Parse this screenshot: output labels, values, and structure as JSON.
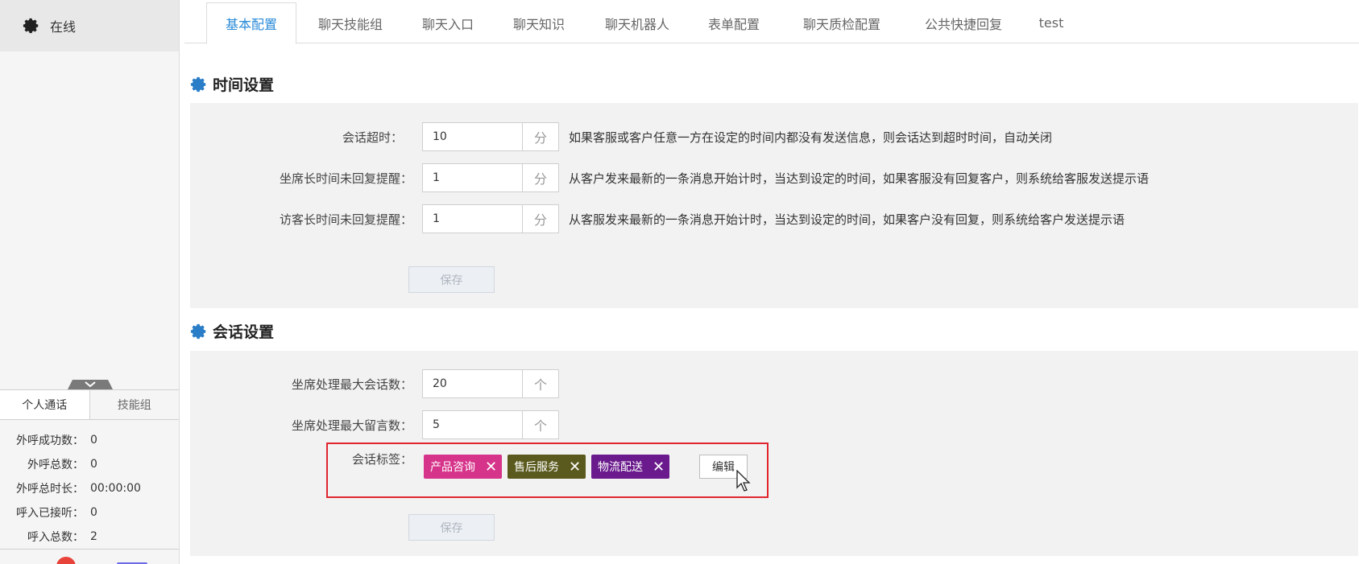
{
  "sidebar": {
    "status_label": "在线",
    "tabs": [
      "个人通话",
      "技能组"
    ],
    "stats": [
      {
        "k": "外呼成功数：",
        "v": "0"
      },
      {
        "k": "外呼总数：",
        "v": "0"
      },
      {
        "k": "外呼总时长：",
        "v": "00:00:00"
      },
      {
        "k": "呼入已接听：",
        "v": "0"
      },
      {
        "k": "呼入总数：",
        "v": "2"
      }
    ]
  },
  "tabs": [
    "基本配置",
    "聊天技能组",
    "聊天入口",
    "聊天知识",
    "聊天机器人",
    "表单配置",
    "聊天质检配置",
    "公共快捷回复",
    "test"
  ],
  "time_settings": {
    "title": "时间设置",
    "rows": [
      {
        "label": "会话超时：",
        "value": "10",
        "unit": "分",
        "desc": "如果客服或客户任意一方在设定的时间内都没有发送信息，则会话达到超时时间，自动关闭"
      },
      {
        "label": "坐席长时间未回复提醒：",
        "value": "1",
        "unit": "分",
        "desc": "从客户发来最新的一条消息开始计时，当达到设定的时间，如果客服没有回复客户，则系统给客服发送提示语"
      },
      {
        "label": "访客长时间未回复提醒：",
        "value": "1",
        "unit": "分",
        "desc": "从客服发来最新的一条消息开始计时，当达到设定的时间，如果客户没有回复，则系统给客户发送提示语"
      }
    ],
    "save": "保存"
  },
  "session_settings": {
    "title": "会话设置",
    "rows": [
      {
        "label": "坐席处理最大会话数：",
        "value": "20",
        "unit": "个"
      },
      {
        "label": "坐席处理最大留言数：",
        "value": "5",
        "unit": "个"
      }
    ],
    "tags_label": "会话标签：",
    "tags": [
      {
        "label": "产品咨询",
        "color": "#d6338a"
      },
      {
        "label": "售后服务",
        "color": "#5a5a1e"
      },
      {
        "label": "物流配送",
        "color": "#6a1a8c"
      }
    ],
    "tag_close": "✕",
    "edit": "编辑",
    "save": "保存"
  },
  "colors": {
    "accent": "#2a8bd8",
    "gear": "#2a7dc7",
    "highlight": "#e0252f"
  }
}
